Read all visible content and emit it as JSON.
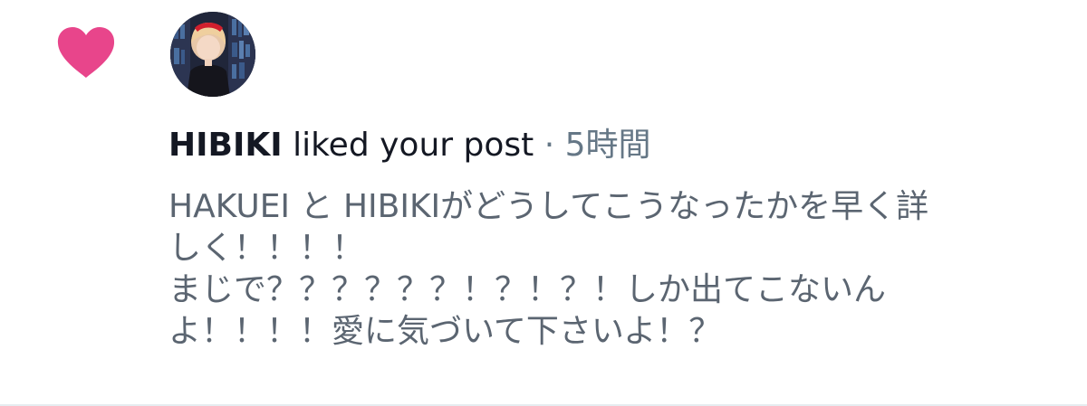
{
  "notification": {
    "type_icon": "heart-icon",
    "avatar_icon": "user-avatar-photo",
    "user_name": "HIBIKI",
    "action_text": " liked your post",
    "separator": " · ",
    "timestamp": "5時間",
    "post_text_lines": [
      "HAKUEI と HIBIKIがどうしてこうなったかを早く詳",
      "しく！！！！",
      "まじで？？？？？？！？！？！しか出てこないん",
      "よ！！！！愛に気づいて下さいよ！？"
    ]
  },
  "colors": {
    "heart": "#e8458b",
    "user_name": "#141823",
    "muted_text": "#657786",
    "post_text": "#5b6571",
    "divider": "#e6ecf0"
  }
}
